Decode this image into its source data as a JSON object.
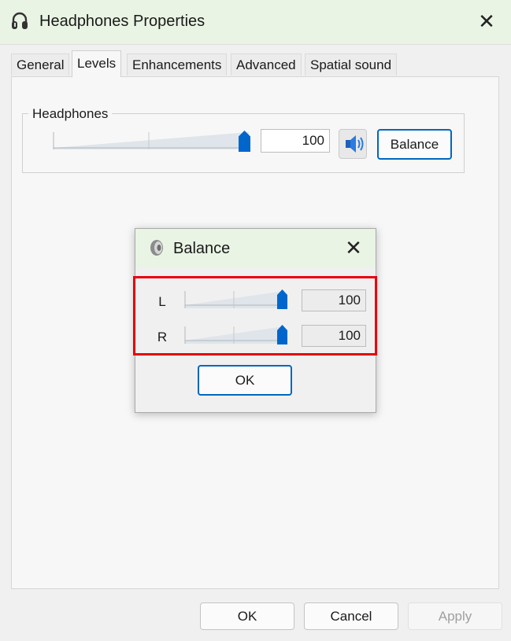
{
  "window": {
    "title": "Headphones Properties",
    "icon": "headphones-icon",
    "close_icon": "close-icon"
  },
  "tabs": [
    {
      "label": "General"
    },
    {
      "label": "Levels",
      "active": true
    },
    {
      "label": "Enhancements"
    },
    {
      "label": "Advanced"
    },
    {
      "label": "Spatial sound"
    }
  ],
  "levels": {
    "group_label": "Headphones",
    "slider_level_percent": 100,
    "value": "100",
    "mute_icon": "speaker-icon",
    "balance_label": "Balance"
  },
  "balance_dialog": {
    "title": "Balance",
    "icon": "speaker-icon",
    "close_icon": "close-icon",
    "channels": [
      {
        "label": "L",
        "value": "100",
        "level_percent": 100
      },
      {
        "label": "R",
        "value": "100",
        "level_percent": 100
      }
    ],
    "ok_label": "OK",
    "highlight_color": "#e8000d"
  },
  "footer": {
    "ok_label": "OK",
    "cancel_label": "Cancel",
    "apply_label": "Apply"
  },
  "colors": {
    "accent": "#0066cc",
    "titlebar": "#e9f4e4"
  }
}
